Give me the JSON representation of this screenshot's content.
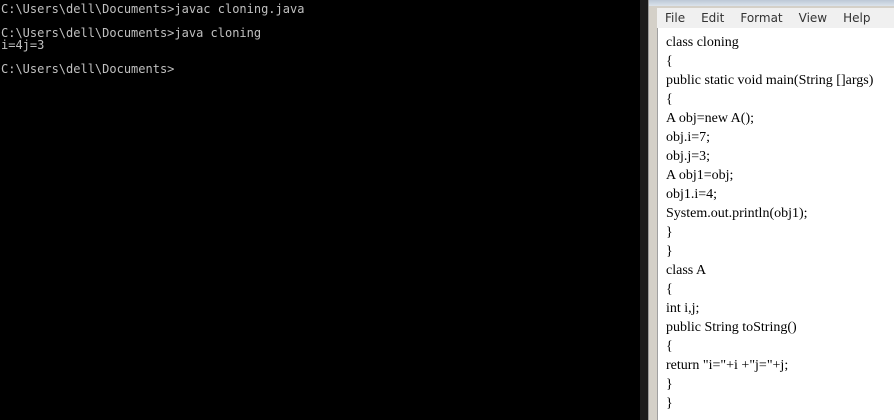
{
  "console": {
    "lines": [
      "C:\\Users\\dell\\Documents>javac cloning.java",
      "",
      "C:\\Users\\dell\\Documents>java cloning",
      "i=4j=3",
      "",
      "C:\\Users\\dell\\Documents>"
    ]
  },
  "notepad": {
    "menu": [
      "File",
      "Edit",
      "Format",
      "View",
      "Help"
    ],
    "code": [
      "class cloning",
      "{",
      "public static void main(String []args)",
      "{",
      "A obj=new A();",
      "obj.i=7;",
      "obj.j=3;",
      "A obj1=obj;",
      "obj1.i=4;",
      "System.out.println(obj1);",
      "}",
      "}",
      "class A",
      "{",
      "int i,j;",
      "public String toString()",
      "{",
      "return \"i=\"+i +\"j=\"+j;",
      "}",
      "}"
    ]
  }
}
